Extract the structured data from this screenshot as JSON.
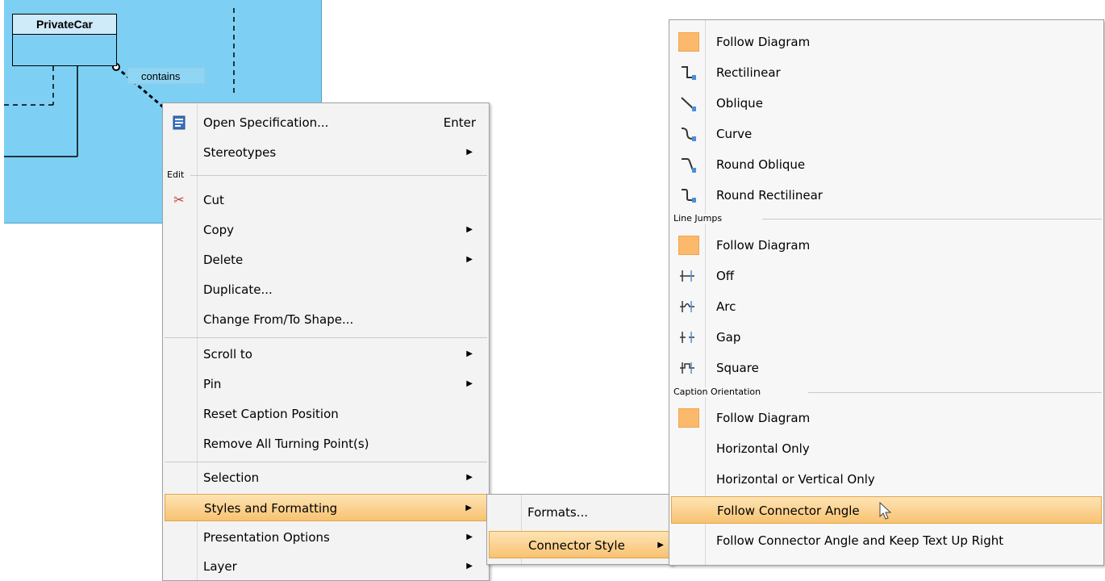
{
  "diagram": {
    "class_name": "PrivateCar",
    "association_label": "contains"
  },
  "context_menu": {
    "items": [
      {
        "label": "Open Specification...",
        "shortcut": "Enter",
        "icon": "specification-icon"
      },
      {
        "label": "Stereotypes",
        "submenu": true
      }
    ],
    "edit_group_label": "Edit",
    "edit_items": [
      {
        "label": "Cut",
        "icon": "scissors-icon"
      },
      {
        "label": "Copy",
        "submenu": true
      },
      {
        "label": "Delete",
        "submenu": true
      },
      {
        "label": "Duplicate..."
      },
      {
        "label": "Change From/To Shape..."
      }
    ],
    "view_items": [
      {
        "label": "Scroll to",
        "submenu": true
      },
      {
        "label": "Pin",
        "submenu": true
      },
      {
        "label": "Reset Caption Position"
      },
      {
        "label": "Remove All Turning Point(s)"
      }
    ],
    "format_items": [
      {
        "label": "Selection",
        "submenu": true
      },
      {
        "label": "Styles and Formatting",
        "submenu": true,
        "highlighted": true
      },
      {
        "label": "Presentation Options",
        "submenu": true
      },
      {
        "label": "Layer",
        "submenu": true
      }
    ]
  },
  "styles_submenu": {
    "items": [
      {
        "label": "Formats..."
      },
      {
        "label": "Connector Style",
        "submenu": true,
        "highlighted": true
      }
    ]
  },
  "connector_style_submenu": {
    "shape_items": [
      {
        "label": "Follow Diagram",
        "icon": "orange-swatch-icon"
      },
      {
        "label": "Rectilinear",
        "icon": "rectilinear-icon"
      },
      {
        "label": "Oblique",
        "icon": "oblique-icon"
      },
      {
        "label": "Curve",
        "icon": "curve-icon"
      },
      {
        "label": "Round Oblique",
        "icon": "round-oblique-icon"
      },
      {
        "label": "Round Rectilinear",
        "icon": "round-rectilinear-icon"
      }
    ],
    "line_jumps_label": "Line Jumps",
    "line_jump_items": [
      {
        "label": "Follow Diagram",
        "icon": "orange-swatch-icon"
      },
      {
        "label": "Off",
        "icon": "jump-off-icon"
      },
      {
        "label": "Arc",
        "icon": "jump-arc-icon"
      },
      {
        "label": "Gap",
        "icon": "jump-gap-icon"
      },
      {
        "label": "Square",
        "icon": "jump-square-icon"
      }
    ],
    "caption_orientation_label": "Caption Orientation",
    "caption_items": [
      {
        "label": "Follow Diagram",
        "icon": "orange-swatch-icon"
      },
      {
        "label": "Horizontal Only"
      },
      {
        "label": "Horizontal or Vertical Only"
      },
      {
        "label": "Follow Connector Angle",
        "highlighted": true
      },
      {
        "label": "Follow Connector Angle and Keep Text Up Right"
      }
    ]
  },
  "colors": {
    "highlight": "#f8c272",
    "diagram_background": "#7dd0f3",
    "swatch": "#fbb96b"
  }
}
